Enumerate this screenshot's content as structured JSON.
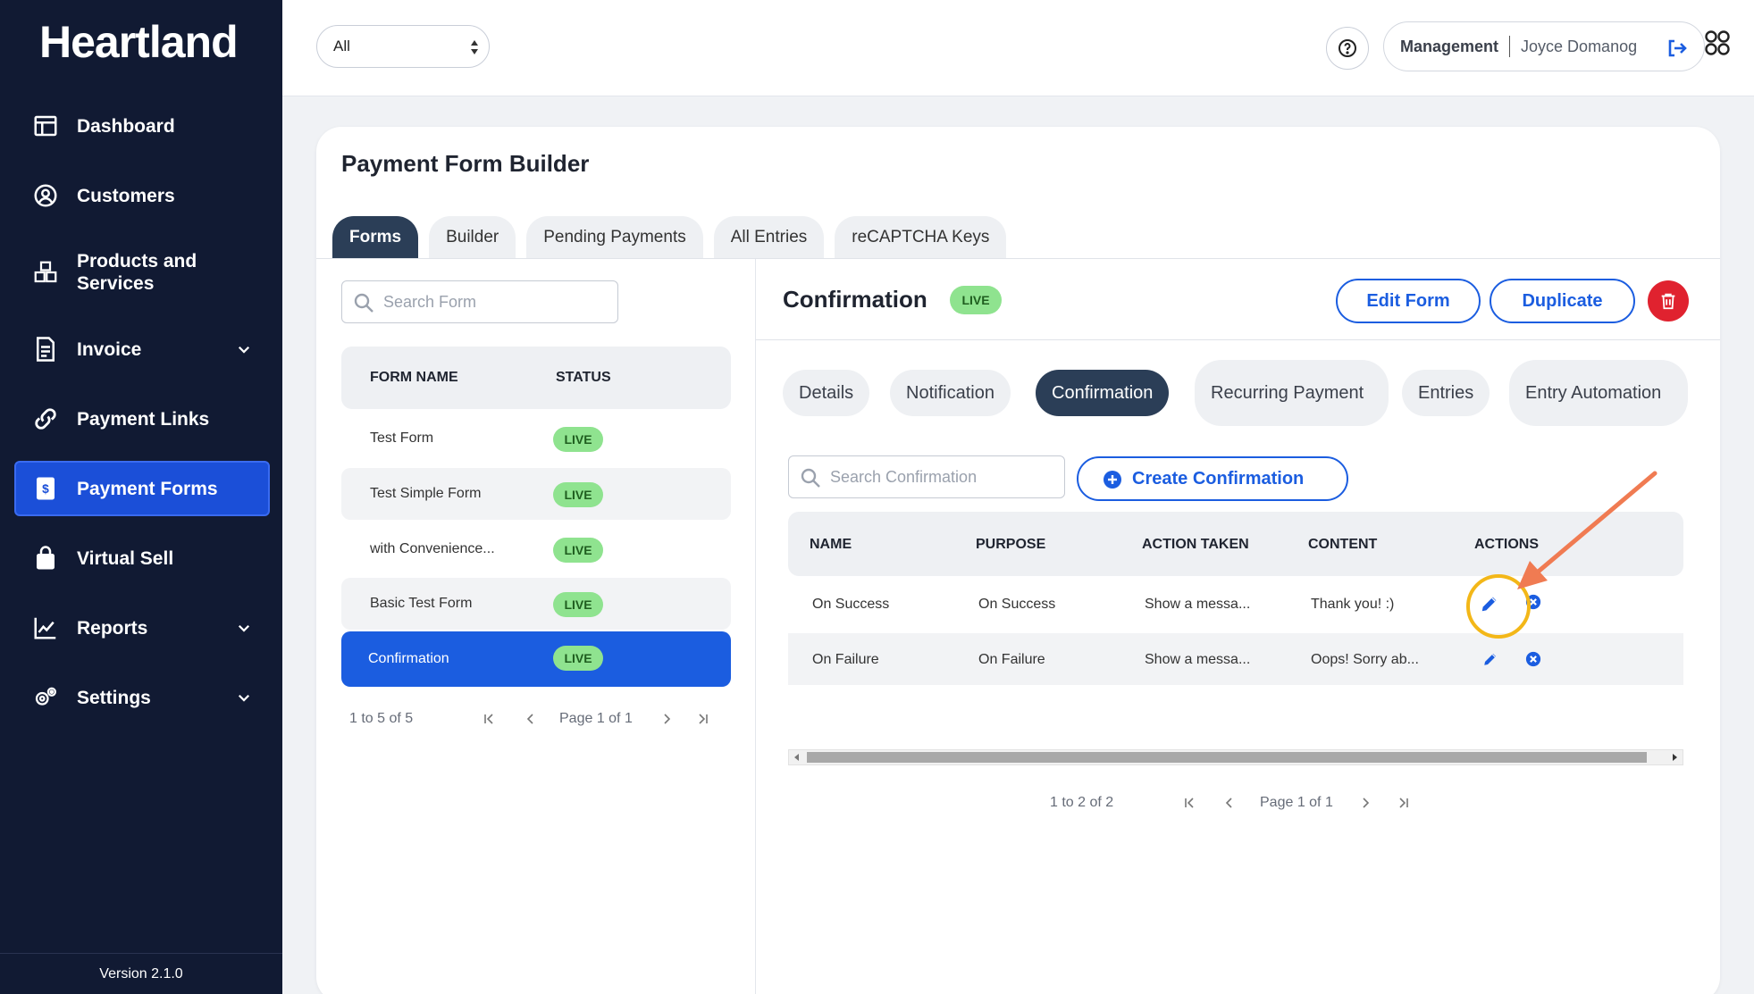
{
  "app": {
    "logo": "Heartland",
    "version": "Version 2.1.0"
  },
  "sidebar": {
    "items": [
      {
        "label": "Dashboard",
        "icon": "dashboard-icon"
      },
      {
        "label": "Customers",
        "icon": "user-circle-icon"
      },
      {
        "label": "Products and Services",
        "icon": "boxes-icon"
      },
      {
        "label": "Invoice",
        "icon": "invoice-icon",
        "expandable": true
      },
      {
        "label": "Payment Links",
        "icon": "link-icon"
      },
      {
        "label": "Payment Forms",
        "icon": "payment-form-icon",
        "active": true
      },
      {
        "label": "Virtual Sell",
        "icon": "shopping-bag-icon"
      },
      {
        "label": "Reports",
        "icon": "chart-icon",
        "expandable": true
      },
      {
        "label": "Settings",
        "icon": "gears-icon",
        "expandable": true
      }
    ]
  },
  "topbar": {
    "filter_value": "All",
    "role": "Management",
    "user_name": "Joyce Domanog"
  },
  "page": {
    "title": "Payment Form Builder",
    "tabs": [
      "Forms",
      "Builder",
      "Pending Payments",
      "All Entries",
      "reCAPTCHA Keys"
    ],
    "active_tab": "Forms"
  },
  "forms_panel": {
    "search_placeholder": "Search Form",
    "columns": [
      "FORM NAME",
      "STATUS"
    ],
    "rows": [
      {
        "name": "Test Form",
        "status": "LIVE"
      },
      {
        "name": "Test Simple Form",
        "status": "LIVE"
      },
      {
        "name": "with Convenience...",
        "status": "LIVE"
      },
      {
        "name": "Basic Test Form",
        "status": "LIVE"
      },
      {
        "name": "Confirmation",
        "status": "LIVE",
        "selected": true
      }
    ],
    "pager": {
      "range": "1 to 5 of 5",
      "page": "Page 1 of 1"
    }
  },
  "detail": {
    "title": "Confirmation",
    "status": "LIVE",
    "edit_label": "Edit Form",
    "duplicate_label": "Duplicate",
    "subtabs": [
      "Details",
      "Notification",
      "Confirmation",
      "Recurring Payment",
      "Entries",
      "Entry Automation"
    ],
    "active_subtab": "Confirmation",
    "search_placeholder": "Search Confirmation",
    "create_label": "Create Confirmation",
    "columns": [
      "NAME",
      "PURPOSE",
      "ACTION TAKEN",
      "CONTENT",
      "ACTIONS"
    ],
    "rows": [
      {
        "name": "On Success",
        "purpose": "On Success",
        "action": "Show a messa...",
        "content": "Thank you! :)"
      },
      {
        "name": "On Failure",
        "purpose": "On Failure",
        "action": "Show a messa...",
        "content": "Oops! Sorry ab..."
      }
    ],
    "pager": {
      "range": "1 to 2 of 2",
      "page": "Page 1 of 1"
    }
  },
  "colors": {
    "sidebar_bg": "#111a33",
    "accent_blue": "#1b5de0",
    "dark_tab": "#2b3e57",
    "live_green": "#8fe38f",
    "delete_red": "#e0222f",
    "annotation_circle": "#f3b718",
    "annotation_arrow": "#f07b52"
  }
}
